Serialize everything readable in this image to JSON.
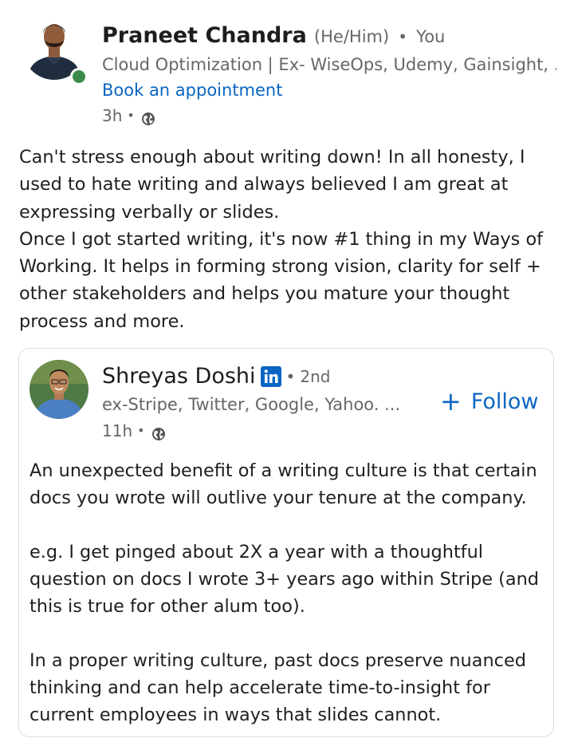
{
  "author": {
    "name": "Praneet Chandra",
    "pronouns": "(He/Him)",
    "degree": "You",
    "headline": "Cloud Optimization | Ex- WiseOps, Udemy, Gainsight, ...",
    "link_label": "Book an appointment",
    "time": "3h",
    "visibility_icon": "globe-icon",
    "presence_color": "#3b8a4b"
  },
  "post": {
    "paragraphs": [
      "Can't stress enough about writing down! In all honesty, I used to hate writing and always believed I am great at expressing verbally or slides.",
      "Once I got started writing, it's now #1 thing in my Ways of Working. It helps in forming strong vision, clarity for self + other stakeholders and helps you mature your thought process and more."
    ]
  },
  "shared": {
    "name": "Shreyas Doshi",
    "badge_icon": "linkedin-icon",
    "degree": "2nd",
    "headline": "ex-Stripe, Twitter, Google, Yahoo. ...",
    "time": "11h",
    "visibility_icon": "globe-icon",
    "follow_label": "Follow",
    "paragraphs": [
      "An unexpected benefit of a writing culture is that certain docs you wrote will outlive your tenure at the company.",
      "e.g. I get pinged about 2X a year with a thoughtful question on docs I wrote 3+ years ago within Stripe (and this is true for other alum too).",
      "In a proper writing culture, past docs preserve nuanced thinking and can help accelerate time-to-insight for current employees in ways that slides cannot."
    ]
  },
  "colors": {
    "link_blue": "#0a66c2",
    "secondary_text": "#666666",
    "primary_text": "#1f1f1f",
    "card_border": "#dcdcdc",
    "linkedin_badge": "#0a66c2"
  }
}
